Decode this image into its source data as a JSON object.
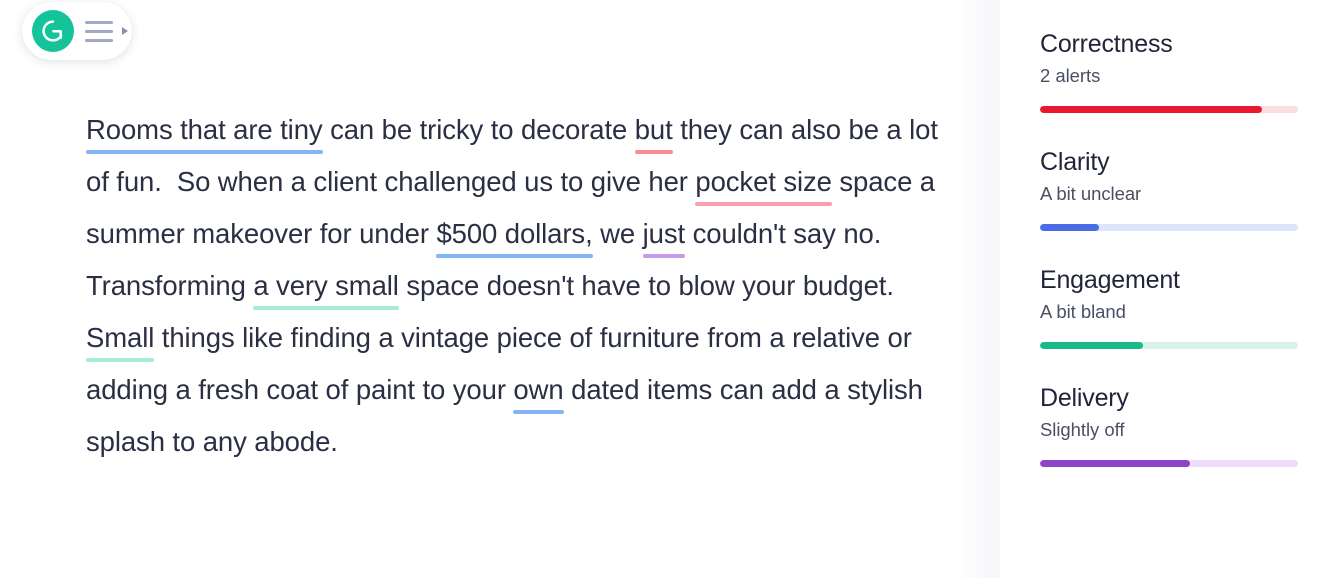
{
  "toolbar": {
    "logo_alt": "Grammarly",
    "menu_label": "menu",
    "expand_label": "expand"
  },
  "document": {
    "segments": [
      {
        "text": "Rooms that are tiny",
        "mark": "blue"
      },
      {
        "text": " can be tricky to decorate ",
        "mark": "none"
      },
      {
        "text": "but",
        "mark": "red"
      },
      {
        "text": " they can also be a lot of fun.  So when a client challenged us to give her ",
        "mark": "none"
      },
      {
        "text": "pocket size",
        "mark": "pink"
      },
      {
        "text": " space a summer makeover for under ",
        "mark": "none"
      },
      {
        "text": "$500 dollars,",
        "mark": "blue"
      },
      {
        "text": " we ",
        "mark": "none"
      },
      {
        "text": "just",
        "mark": "purple"
      },
      {
        "text": " couldn't say no. Transforming ",
        "mark": "none"
      },
      {
        "text": "a very small",
        "mark": "green"
      },
      {
        "text": " space doesn't have to blow your budget. ",
        "mark": "none"
      },
      {
        "text": "Small",
        "mark": "green"
      },
      {
        "text": " things like finding a vintage piece of furniture from a relative or adding a fresh coat of paint to your ",
        "mark": "none"
      },
      {
        "text": "own",
        "mark": "blue"
      },
      {
        "text": " dated items can add a stylish splash to any abode.",
        "mark": "none"
      }
    ]
  },
  "sidebar": {
    "metrics": [
      {
        "name": "Correctness",
        "status": "2 alerts",
        "percent": 86,
        "fill_color": "#e8182f",
        "track_color": "#fbdde0"
      },
      {
        "name": "Clarity",
        "status": "A bit unclear",
        "percent": 23,
        "fill_color": "#4a6de5",
        "track_color": "#dce5fa"
      },
      {
        "name": "Engagement",
        "status": "A bit bland",
        "percent": 40,
        "fill_color": "#19b98a",
        "track_color": "#d6f2e9"
      },
      {
        "name": "Delivery",
        "status": "Slightly off",
        "percent": 58,
        "fill_color": "#8e44c9",
        "track_color": "#eedcfa"
      }
    ]
  },
  "theme": {
    "text_color": "#2b2f44",
    "logo_color": "#15c39a",
    "mark_blue": "#85b4f2",
    "mark_red": "#fb8b96",
    "mark_pink": "#f9a0ab",
    "mark_purple": "#c79bea",
    "mark_green": "#a5ecd2"
  }
}
